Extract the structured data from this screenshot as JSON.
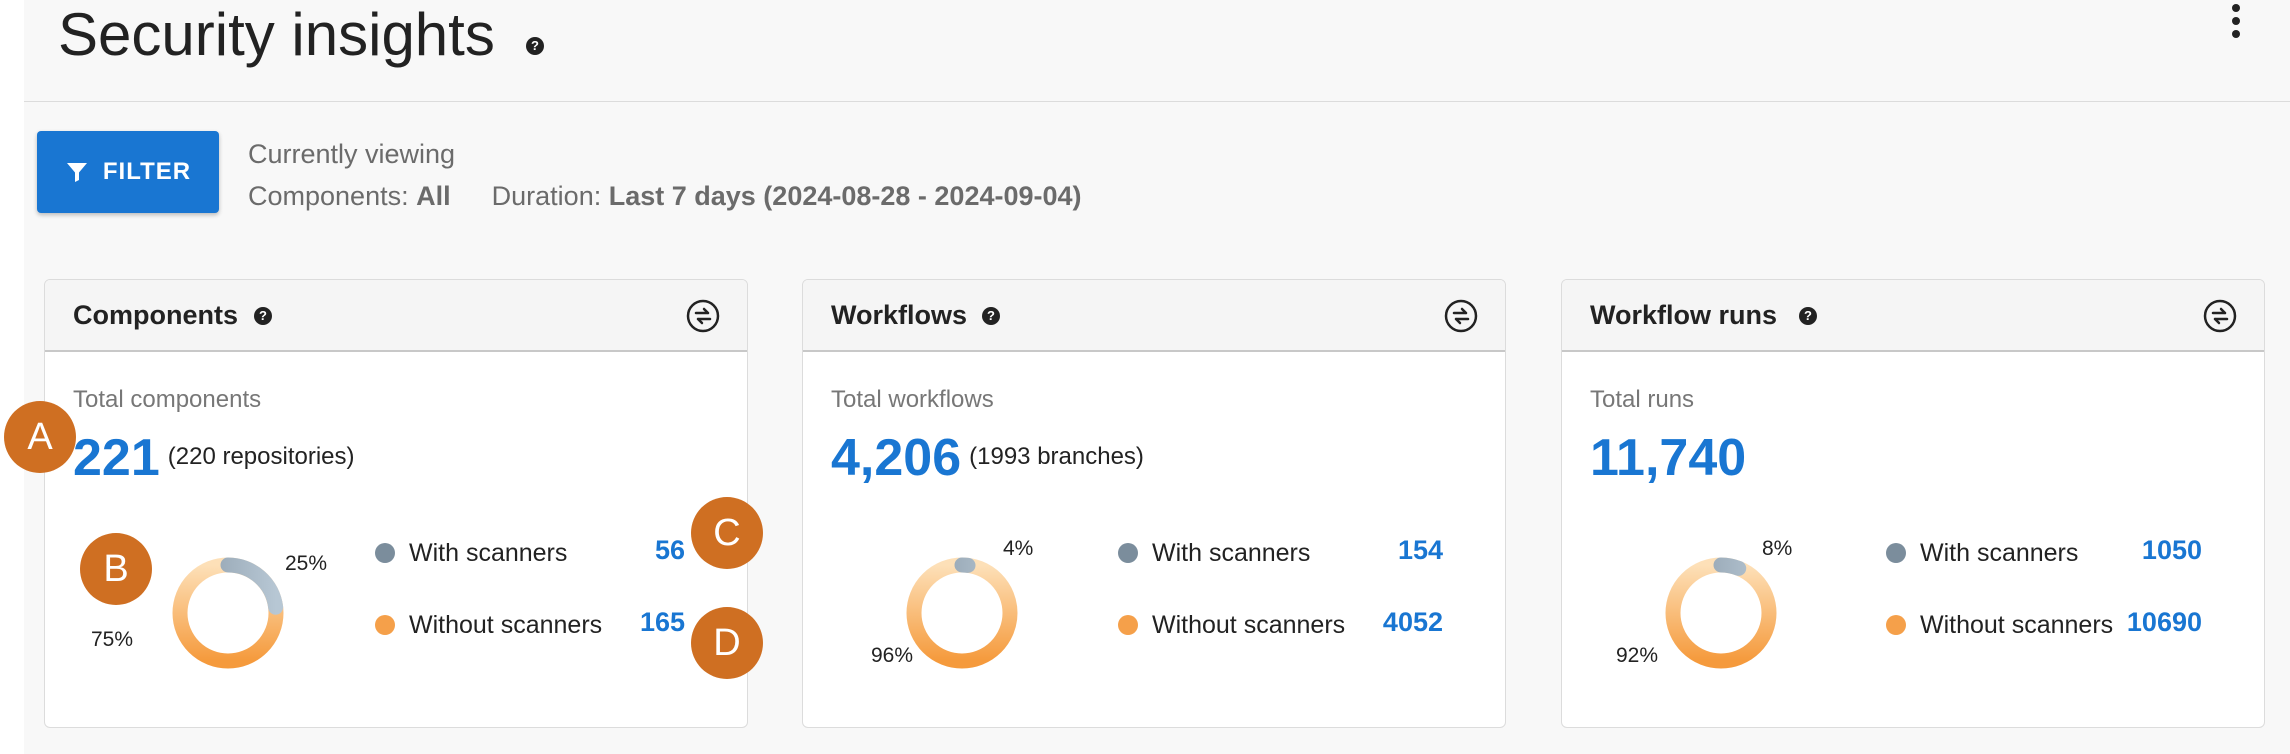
{
  "header": {
    "title": "Security insights",
    "help": "?"
  },
  "filter": {
    "button_label": "FILTER",
    "currently_viewing": "Currently viewing",
    "components_label": "Components:",
    "components_value": "All",
    "duration_label": "Duration:",
    "duration_value": "Last 7 days (2024-08-28 - 2024-09-04)"
  },
  "cards": [
    {
      "title": "Components",
      "total_label": "Total components",
      "total_value": "221",
      "total_sub": "(220 repositories)",
      "with_pct": "25%",
      "without_pct": "75%",
      "with_fraction": 0.25,
      "with_label": "With scanners",
      "with_value": "56",
      "without_label": "Without scanners",
      "without_value": "165"
    },
    {
      "title": "Workflows",
      "total_label": "Total workflows",
      "total_value": "4,206",
      "total_sub": "(1993 branches)",
      "with_pct": "4%",
      "without_pct": "96%",
      "with_fraction": 0.04,
      "with_label": "With scanners",
      "with_value": "154",
      "without_label": "Without scanners",
      "without_value": "4052"
    },
    {
      "title": "Workflow runs",
      "total_label": "Total runs",
      "total_value": "11,740",
      "total_sub": "",
      "with_pct": "8%",
      "without_pct": "92%",
      "with_fraction": 0.08,
      "with_label": "With scanners",
      "with_value": "1050",
      "without_label": "Without scanners",
      "without_value": "10690"
    }
  ],
  "markers": [
    "A",
    "B",
    "C",
    "D"
  ],
  "colors": {
    "accent": "#1976d2",
    "with_scanners": "#7b8d9c",
    "without_scanners": "#f5a04a",
    "marker": "#cf6f22"
  }
}
